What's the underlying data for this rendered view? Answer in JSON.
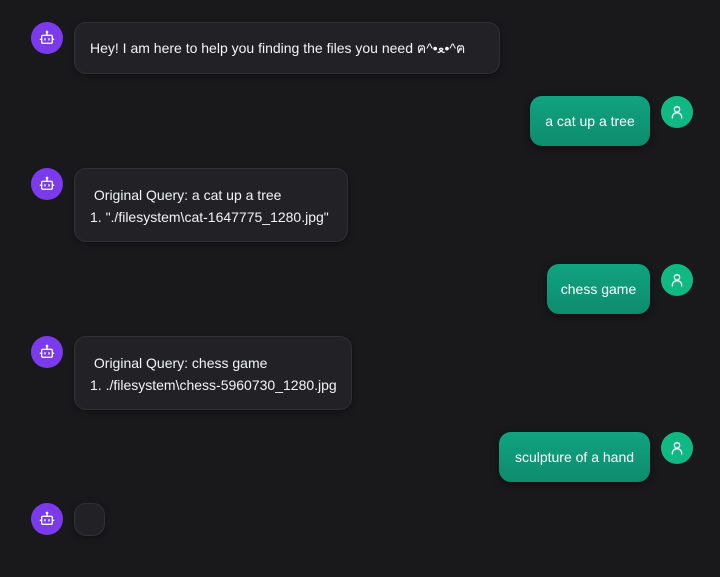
{
  "messages": [
    {
      "role": "bot",
      "lines": [
        "Hey! I am here to help you finding the files you need ฅ^•ﻌ•^ฅ"
      ]
    },
    {
      "role": "user",
      "text": "a cat up a tree"
    },
    {
      "role": "bot",
      "lines": [
        " Original Query: a cat up a tree",
        "1. \"./filesystem\\cat-1647775_1280.jpg\""
      ]
    },
    {
      "role": "user",
      "text": "chess game"
    },
    {
      "role": "bot",
      "lines": [
        " Original Query: chess game",
        "1. ./filesystem\\chess-5960730_1280.jpg"
      ]
    },
    {
      "role": "user",
      "text": "sculpture of a hand"
    },
    {
      "role": "bot",
      "lines": []
    }
  ],
  "icons": {
    "bot_avatar": "robot-icon",
    "user_avatar": "user-icon"
  },
  "colors": {
    "background": "#19191b",
    "bot_avatar": "#7c3aed",
    "user_avatar": "#10b981",
    "user_bubble": "#10a37f",
    "bot_bubble": "#222226"
  }
}
